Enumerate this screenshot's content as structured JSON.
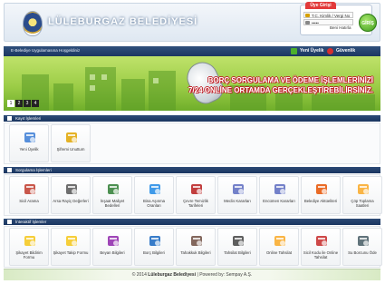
{
  "header": {
    "title": "LÜLEBURGAZ BELEDİYESİ",
    "login": {
      "tab_label": "Üye Girişi",
      "tc_placeholder": "T.C. Kimlik / Vergi No",
      "password_value": "•••••",
      "forgot_label": "Beni Hatırla",
      "go_label": "GİRİŞ"
    }
  },
  "navbar": {
    "text": "E-Belediye Uygulamasına Hoşgeldiniz",
    "new_member_label": "Yeni Üyelik",
    "security_label": "Güvenlik",
    "new_member_color": "#4caf2c",
    "security_color": "#d32f2f"
  },
  "banner": {
    "line1": "BORÇ SORGULAMA VE ÖDEME İŞLEMLERİNİZİ",
    "line2": "7/24 ONLİNE ORTAMDA GERÇEKLEŞTİREBİLİRSİNİZ.",
    "slides": [
      "1",
      "2",
      "3",
      "4"
    ],
    "active_slide": "1"
  },
  "sections": {
    "membership": {
      "title": "Kayıt İşlemleri",
      "items": [
        {
          "label": "Yeni Üyelik",
          "icon": "new-user-icon",
          "color": "#3a7bd5"
        },
        {
          "label": "Şifremi Unuttum",
          "icon": "forgot-password-icon",
          "color": "#e0a400"
        }
      ]
    },
    "queries": {
      "title": "Sorgulama İşlemleri",
      "items": [
        {
          "label": "Sicil Arama",
          "icon": "user-search-icon",
          "color": "#c0392b"
        },
        {
          "label": "Arsa Rayiç Değerleri",
          "icon": "magnifier-icon",
          "color": "#555555"
        },
        {
          "label": "İnşaat Maliyet Bedelleri",
          "icon": "blueprint-icon",
          "color": "#2e7d32"
        },
        {
          "label": "Bina Aşınma Oranları",
          "icon": "pie-chart-icon",
          "color": "#1e88e5"
        },
        {
          "label": "Çevre Temizlik Tarifeleri",
          "icon": "clock-icon",
          "color": "#b71c1c"
        },
        {
          "label": "Meclis Kararları",
          "icon": "document-check-icon",
          "color": "#5c6bc0"
        },
        {
          "label": "Encümen Kararları",
          "icon": "document-pen-icon",
          "color": "#5c6bc0"
        },
        {
          "label": "Belediye Aktüeliteri",
          "icon": "megaphone-icon",
          "color": "#e65100"
        },
        {
          "label": "Çöp Toplama Saatleri",
          "icon": "truck-clock-icon",
          "color": "#f9a825"
        }
      ]
    },
    "interactive": {
      "title": "İnteraktif İşlemler",
      "items": [
        {
          "label": "Şikayet Bildirim Formu",
          "icon": "envelope-icon",
          "color": "#f5c518"
        },
        {
          "label": "Şikayet Takip Formu",
          "icon": "envelope-search-icon",
          "color": "#f5c518"
        },
        {
          "label": "Beyan Bilgileri",
          "icon": "form-icon",
          "color": "#8e24aa"
        },
        {
          "label": "Borç Bilgileri",
          "icon": "books-icon",
          "color": "#1565c0"
        },
        {
          "label": "Tahakkuk Bilgileri",
          "icon": "ledger-icon",
          "color": "#6d4c41"
        },
        {
          "label": "Tahsilat Bilgileri",
          "icon": "card-icon",
          "color": "#424242"
        },
        {
          "label": "Online Tahsilat",
          "icon": "credit-card-icon",
          "color": "#f9a825"
        },
        {
          "label": "Sicil Kodu ile Online Tahsilat",
          "icon": "card-key-icon",
          "color": "#c62828"
        },
        {
          "label": "Su Borcunu Öde",
          "icon": "water-tap-icon",
          "color": "#455a64"
        }
      ]
    }
  },
  "footer": {
    "prefix": "© 2014",
    "org": "Lüleburgaz Belediyesi",
    "separator": "|",
    "powered": "Powered by: Sempay A.Ş."
  }
}
